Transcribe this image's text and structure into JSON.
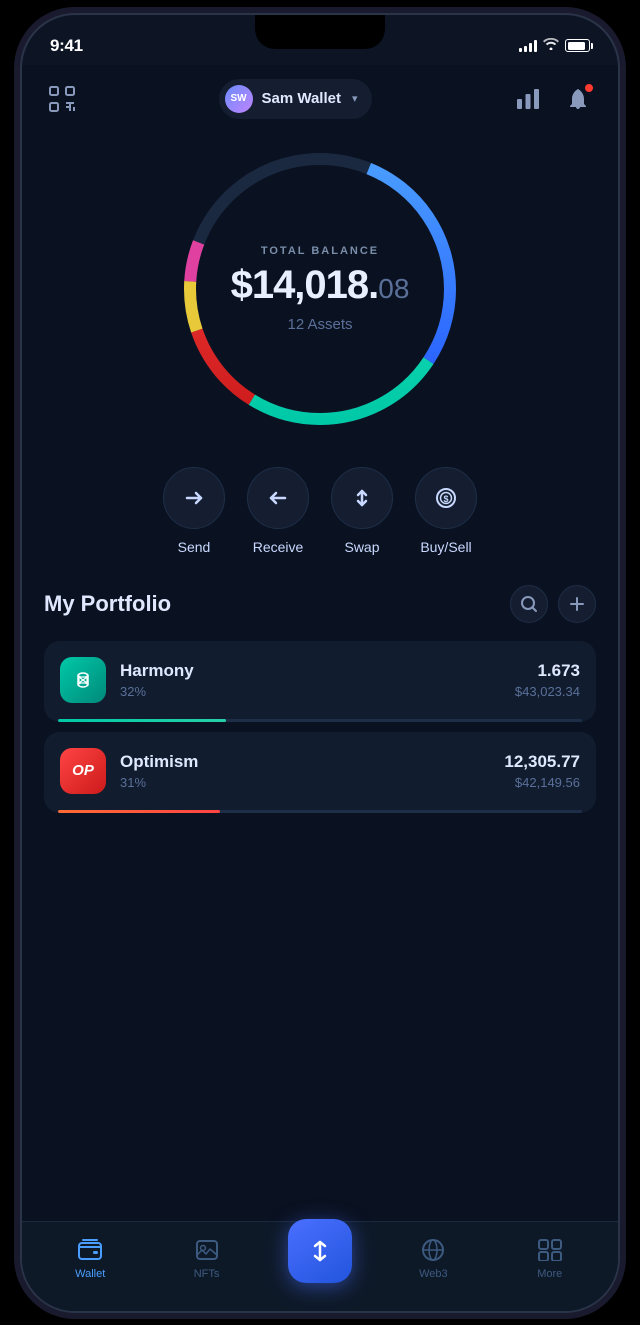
{
  "status_bar": {
    "time": "9:41"
  },
  "header": {
    "wallet_initials": "SW",
    "wallet_name": "Sam Wallet",
    "dropdown_label": "▾"
  },
  "balance": {
    "label": "TOTAL BALANCE",
    "main": "$14,018.",
    "cents": "08",
    "assets_count": "12 Assets"
  },
  "actions": [
    {
      "id": "send",
      "label": "Send"
    },
    {
      "id": "receive",
      "label": "Receive"
    },
    {
      "id": "swap",
      "label": "Swap"
    },
    {
      "id": "buysell",
      "label": "Buy/Sell"
    }
  ],
  "portfolio": {
    "title": "My Portfolio",
    "assets": [
      {
        "name": "Harmony",
        "symbol": "HH",
        "percent": "32%",
        "amount": "1.673",
        "usd": "$43,023.34",
        "progress": 32,
        "type": "harmony"
      },
      {
        "name": "Optimism",
        "symbol": "OP",
        "percent": "31%",
        "amount": "12,305.77",
        "usd": "$42,149.56",
        "progress": 31,
        "type": "optimism"
      }
    ]
  },
  "bottom_nav": {
    "items": [
      {
        "id": "wallet",
        "label": "Wallet",
        "active": true
      },
      {
        "id": "nfts",
        "label": "NFTs",
        "active": false
      },
      {
        "id": "center",
        "label": "",
        "center": true
      },
      {
        "id": "web3",
        "label": "Web3",
        "active": false
      },
      {
        "id": "more",
        "label": "More",
        "active": false
      }
    ]
  }
}
